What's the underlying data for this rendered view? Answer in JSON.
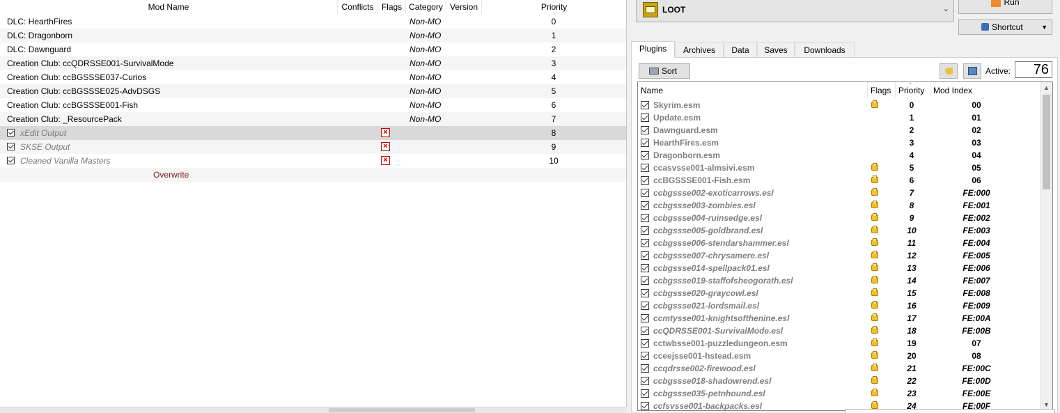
{
  "mod_list": {
    "headers": {
      "name": "Mod Name",
      "conflicts": "Conflicts",
      "flags": "Flags",
      "category": "Category",
      "version": "Version",
      "priority": "Priority"
    },
    "rows": [
      {
        "name": "DLC: HearthFires",
        "category": "Non-MO",
        "priority": "0",
        "kind": "dlc"
      },
      {
        "name": "DLC: Dragonborn",
        "category": "Non-MO",
        "priority": "1",
        "kind": "dlc"
      },
      {
        "name": "DLC: Dawnguard",
        "category": "Non-MO",
        "priority": "2",
        "kind": "dlc"
      },
      {
        "name": "Creation Club: ccQDRSSE001-SurvivalMode",
        "category": "Non-MO",
        "priority": "3",
        "kind": "dlc"
      },
      {
        "name": "Creation Club: ccBGSSSE037-Curios",
        "category": "Non-MO",
        "priority": "4",
        "kind": "dlc"
      },
      {
        "name": "Creation Club: ccBGSSSE025-AdvDSGS",
        "category": "Non-MO",
        "priority": "5",
        "kind": "dlc"
      },
      {
        "name": "Creation Club: ccBGSSSE001-Fish",
        "category": "Non-MO",
        "priority": "6",
        "kind": "dlc"
      },
      {
        "name": "Creation Club: _ResourcePack",
        "category": "Non-MO",
        "priority": "7",
        "kind": "dlc"
      },
      {
        "name": "xEdit Output",
        "category": "",
        "priority": "8",
        "kind": "mod",
        "selected": true
      },
      {
        "name": "SKSE Output",
        "category": "",
        "priority": "9",
        "kind": "mod"
      },
      {
        "name": "Cleaned Vanilla Masters",
        "category": "",
        "priority": "10",
        "kind": "mod"
      },
      {
        "name": "Overwrite",
        "category": "",
        "priority": "",
        "kind": "overwrite"
      }
    ]
  },
  "toolbar": {
    "executable": "LOOT",
    "run_label": "Run",
    "shortcut_label": "Shortcut"
  },
  "tabs": [
    "Plugins",
    "Archives",
    "Data",
    "Saves",
    "Downloads"
  ],
  "plugins": {
    "sort_label": "Sort",
    "active_label": "Active:",
    "active_count": "76",
    "headers": {
      "name": "Name",
      "flags": "Flags",
      "priority": "Priority",
      "mod_index": "Mod Index"
    },
    "rows": [
      {
        "name": "Skyrim.esm",
        "flag": true,
        "priority": "0",
        "index": "00",
        "esl": false
      },
      {
        "name": "Update.esm",
        "flag": false,
        "priority": "1",
        "index": "01",
        "esl": false
      },
      {
        "name": "Dawnguard.esm",
        "flag": false,
        "priority": "2",
        "index": "02",
        "esl": false
      },
      {
        "name": "HearthFires.esm",
        "flag": false,
        "priority": "3",
        "index": "03",
        "esl": false
      },
      {
        "name": "Dragonborn.esm",
        "flag": false,
        "priority": "4",
        "index": "04",
        "esl": false
      },
      {
        "name": "ccasvsse001-almsivi.esm",
        "flag": true,
        "priority": "5",
        "index": "05",
        "esl": false
      },
      {
        "name": "ccBGSSSE001-Fish.esm",
        "flag": true,
        "priority": "6",
        "index": "06",
        "esl": false
      },
      {
        "name": "ccbgssse002-exoticarrows.esl",
        "flag": true,
        "priority": "7",
        "index": "FE:000",
        "esl": true
      },
      {
        "name": "ccbgssse003-zombies.esl",
        "flag": true,
        "priority": "8",
        "index": "FE:001",
        "esl": true
      },
      {
        "name": "ccbgssse004-ruinsedge.esl",
        "flag": true,
        "priority": "9",
        "index": "FE:002",
        "esl": true
      },
      {
        "name": "ccbgssse005-goldbrand.esl",
        "flag": true,
        "priority": "10",
        "index": "FE:003",
        "esl": true
      },
      {
        "name": "ccbgssse006-stendarshammer.esl",
        "flag": true,
        "priority": "11",
        "index": "FE:004",
        "esl": true
      },
      {
        "name": "ccbgssse007-chrysamere.esl",
        "flag": true,
        "priority": "12",
        "index": "FE:005",
        "esl": true
      },
      {
        "name": "ccbgssse014-spellpack01.esl",
        "flag": true,
        "priority": "13",
        "index": "FE:006",
        "esl": true
      },
      {
        "name": "ccbgssse019-staffofsheogorath.esl",
        "flag": true,
        "priority": "14",
        "index": "FE:007",
        "esl": true
      },
      {
        "name": "ccbgssse020-graycowl.esl",
        "flag": true,
        "priority": "15",
        "index": "FE:008",
        "esl": true
      },
      {
        "name": "ccbgssse021-lordsmail.esl",
        "flag": true,
        "priority": "16",
        "index": "FE:009",
        "esl": true
      },
      {
        "name": "ccmtysse001-knightsofthenine.esl",
        "flag": true,
        "priority": "17",
        "index": "FE:00A",
        "esl": true
      },
      {
        "name": "ccQDRSSE001-SurvivalMode.esl",
        "flag": true,
        "priority": "18",
        "index": "FE:00B",
        "esl": true
      },
      {
        "name": "cctwbsse001-puzzledungeon.esm",
        "flag": true,
        "priority": "19",
        "index": "07",
        "esl": false
      },
      {
        "name": "cceejsse001-hstead.esm",
        "flag": true,
        "priority": "20",
        "index": "08",
        "esl": false
      },
      {
        "name": "ccqdrsse002-firewood.esl",
        "flag": true,
        "priority": "21",
        "index": "FE:00C",
        "esl": true
      },
      {
        "name": "ccbgssse018-shadowrend.esl",
        "flag": true,
        "priority": "22",
        "index": "FE:00D",
        "esl": true
      },
      {
        "name": "ccbgssse035-petnhound.esl",
        "flag": true,
        "priority": "23",
        "index": "FE:00E",
        "esl": true
      },
      {
        "name": "ccfsvsse001-backpacks.esl",
        "flag": true,
        "priority": "24",
        "index": "FE:00F",
        "esl": true
      }
    ]
  }
}
